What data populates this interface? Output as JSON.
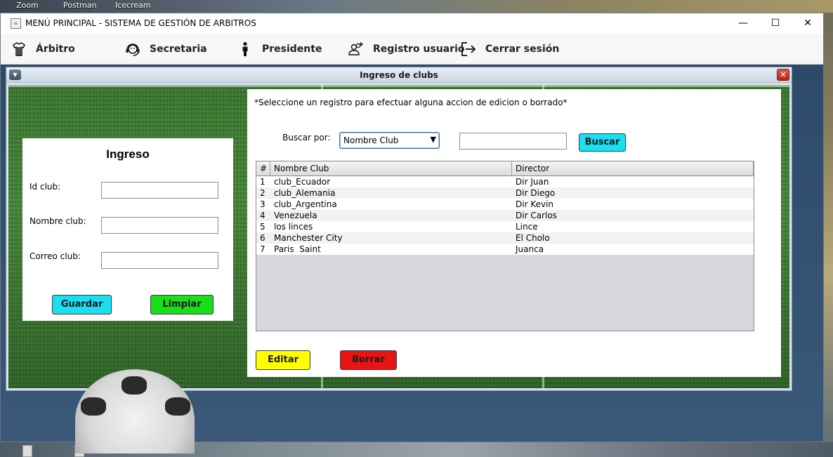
{
  "desktop": {
    "top_labels": [
      "Zoom",
      "Postman",
      "Icecream"
    ]
  },
  "window": {
    "title": "MENÚ PRINCIPAL - SISTEMA DE GESTIÓN DE ARBITROS",
    "minimize_glyph": "—",
    "maximize_glyph": "☐",
    "close_glyph": "✕"
  },
  "menubar": {
    "items": [
      {
        "label": "Árbitro",
        "icon": "referee-icon"
      },
      {
        "label": "Secretaria",
        "icon": "headset-icon"
      },
      {
        "label": "Presidente",
        "icon": "person-icon"
      },
      {
        "label": "Registro usuario",
        "icon": "add-user-icon"
      },
      {
        "label": "Cerrar sesión",
        "icon": "logout-icon"
      }
    ]
  },
  "internal_frame": {
    "title": "Ingreso de clubs",
    "close_glyph": "✕",
    "menu_glyph": "▼"
  },
  "form": {
    "heading": "Ingreso",
    "fields": [
      {
        "label": "Id club:",
        "value": ""
      },
      {
        "label": "Nombre club:",
        "value": ""
      },
      {
        "label": "Correo club:",
        "value": ""
      }
    ],
    "save_label": "Guardar",
    "clear_label": "Limpiar"
  },
  "list_panel": {
    "instruction": "*Seleccione un registro para efectuar alguna accion de edicion o borrado*",
    "search_label": "Buscar por:",
    "search_by_selected": "Nombre Club",
    "search_value": "",
    "search_button": "Buscar",
    "table": {
      "columns": [
        "#",
        "Nombre Club",
        "Director"
      ],
      "rows": [
        [
          "1",
          "club_Ecuador",
          "Dir Juan"
        ],
        [
          "2",
          "club_Alemania",
          "Dir Diego"
        ],
        [
          "3",
          "club_Argentina",
          "Dir Kevin"
        ],
        [
          "4",
          "Venezuela",
          "Dir Carlos"
        ],
        [
          "5",
          "los linces",
          "Lince"
        ],
        [
          "6",
          "Manchester City",
          "El Cholo"
        ],
        [
          "7",
          "Paris  Saint",
          "Juanca"
        ]
      ]
    },
    "edit_label": "Editar",
    "delete_label": "Borrar"
  },
  "colors": {
    "save_button": "#19e0f0",
    "clear_button": "#18e018",
    "search_button": "#19e0f0",
    "edit_button": "#ffff00",
    "delete_button": "#e81414"
  }
}
